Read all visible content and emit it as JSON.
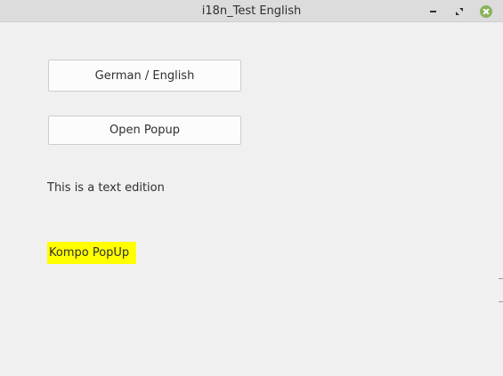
{
  "window": {
    "title": "i18n_Test English"
  },
  "controls": {
    "minimize_icon": "minimize-icon",
    "maximize_icon": "restore-icon",
    "close_icon": "close-icon"
  },
  "buttons": {
    "language_toggle": "German / English",
    "open_popup": "Open Popup"
  },
  "labels": {
    "text_edition": "This is a text edition",
    "popup": "Kompo PopUp"
  },
  "colors": {
    "popup_highlight": "#ffff00",
    "close_button": "#8ab25f",
    "window_background": "#f0f0f0"
  }
}
